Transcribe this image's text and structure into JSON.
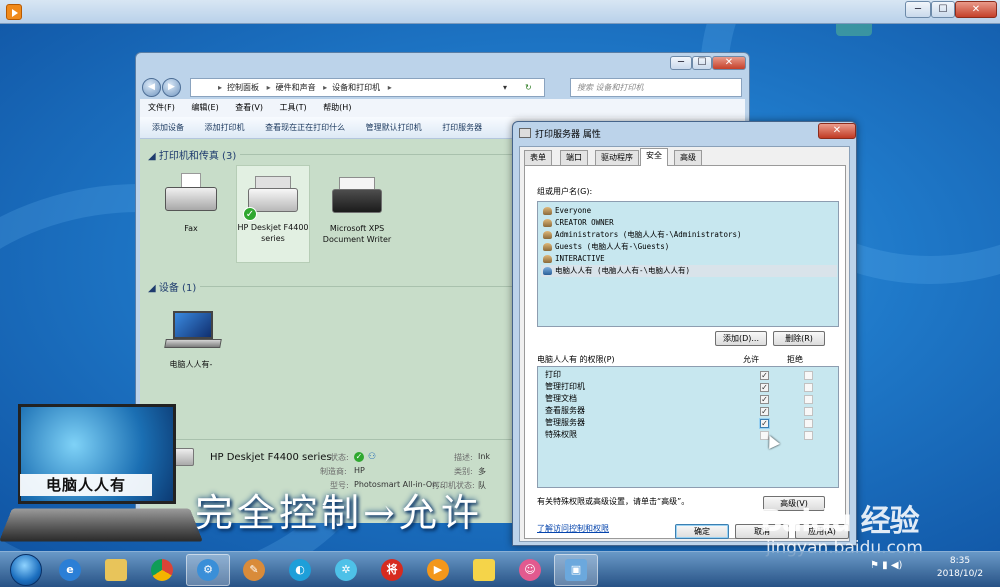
{
  "colors": {
    "accent": "#1a74c2",
    "dialog_bg": "#f0f0f0",
    "list_bg": "#c7e7ef",
    "explorer_bg": "#c8ddc9"
  },
  "outer_window": {
    "min": "─",
    "max": "☐",
    "close": "✕"
  },
  "explorer": {
    "breadcrumb": [
      "控制面板",
      "硬件和声音",
      "设备和打印机"
    ],
    "search_placeholder": "搜索 设备和打印机",
    "menu": [
      "文件(F)",
      "编辑(E)",
      "查看(V)",
      "工具(T)",
      "帮助(H)"
    ],
    "toolbar": [
      "添加设备",
      "添加打印机",
      "查看现在正在打印什么",
      "管理默认打印机",
      "打印服务器"
    ],
    "printers_group": "打印机和传真 (3)",
    "printers": [
      {
        "name": "Fax",
        "icon": "fax-icon"
      },
      {
        "name": "HP Deskjet F4400 series",
        "icon": "printer-icon"
      },
      {
        "name": "Microsoft XPS Document Writer",
        "icon": "printer-icon"
      }
    ],
    "devices_group": "设备 (1)",
    "devices": [
      {
        "name": "电脑人人有-",
        "icon": "laptop-icon"
      }
    ],
    "details": {
      "name": "HP Deskjet F4400 series",
      "status_label": "状态:",
      "maker_label": "制造商:",
      "maker": "HP",
      "model_label": "型号:",
      "model": "Photosmart All-in-On...",
      "desc_label": "描述:",
      "desc_value": "Ink",
      "category_label": "类别:",
      "category_value": "多",
      "printer_status_label": "打印机状态:",
      "printer_status_value": "队"
    }
  },
  "dialog": {
    "title": "打印服务器 属性",
    "tabs": [
      "表单",
      "端口",
      "驱动程序",
      "安全",
      "高级"
    ],
    "active_tab": "安全",
    "users_label": "组或用户名(G):",
    "users": [
      "Everyone",
      "CREATOR OWNER",
      "Administrators (电脑人人有-\\Administrators)",
      "Guests (电脑人人有-\\Guests)",
      "INTERACTIVE",
      "电脑人人有 (电脑人人有-\\电脑人人有)"
    ],
    "add_button": "添加(D)...",
    "remove_button": "删除(R)",
    "perm_label": "电脑人人有 的权限(P)",
    "allow_label": "允许",
    "deny_label": "拒绝",
    "permissions": [
      {
        "name": "打印",
        "allow": true,
        "deny": false
      },
      {
        "name": "管理打印机",
        "allow": true,
        "deny": false
      },
      {
        "name": "管理文档",
        "allow": true,
        "deny": false
      },
      {
        "name": "查看服务器",
        "allow": true,
        "deny": false
      },
      {
        "name": "管理服务器",
        "allow": true,
        "deny": false
      },
      {
        "name": "特殊权限",
        "allow": false,
        "deny": false
      }
    ],
    "advanced_note": "有关特殊权限或高级设置，请单击“高级”。",
    "advanced_button": "高级(V)",
    "learn_link": "了解访问控制和权限",
    "ok_button": "确定",
    "cancel_button": "取消",
    "apply_button": "应用(A)"
  },
  "overlay": {
    "logo_text": "电脑人人有",
    "caption": "完全控制→允许",
    "watermark_brand": "Baidu 经验",
    "watermark_url": "jingyan.baidu.com"
  },
  "taskbar": {
    "apps": [
      "ie-icon",
      "folder-icon",
      "chrome-icon",
      "app-icon",
      "paint-icon",
      "browser-icon",
      "pinwheel-icon",
      "general-icon",
      "media-icon",
      "notes-icon",
      "game-icon",
      "devices-icon"
    ],
    "time": "8:35",
    "date": "2018/10/2"
  }
}
